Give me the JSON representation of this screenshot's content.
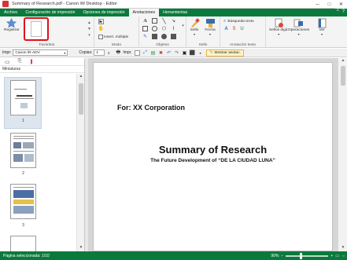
{
  "window": {
    "title": "Summary of Research.pdf - Canon iW Desktop - Editor",
    "minimize": "─",
    "maximize": "□",
    "close": "✕"
  },
  "menu": {
    "tabs": [
      {
        "label": "Archivo",
        "active": false
      },
      {
        "label": "Configuración de impresión",
        "active": false
      },
      {
        "label": "Opciones de impresión",
        "active": false
      },
      {
        "label": "Anotaciones",
        "active": true
      },
      {
        "label": "Herramientas",
        "active": false
      }
    ],
    "help": "?",
    "collapse": "^"
  },
  "ribbon": {
    "register_label": "Registrar",
    "insert_multiple": "Insert. múltiple",
    "stamp_label": "Sello",
    "date_label": "Fecha",
    "search_text_label": "Búsqueda texto",
    "digital_stamps_label": "Sellos digit.",
    "operations_label": "Operaciones",
    "view_label": "Ver",
    "groups": {
      "favorites": "Favoritos",
      "mode": "Modo",
      "objects": "Objetos",
      "stamp": "Sello",
      "text_annotation": "Anotación texto"
    }
  },
  "toolbar": {
    "printer_label": "Impr:",
    "printer_value": "Canon iR-ADV",
    "copies_label": "Copias:",
    "copies_value": "1",
    "print_label": "Impr.",
    "show_annotations": "Mostrar anotac."
  },
  "sidepanel": {
    "header": "Miniaturas",
    "pages": [
      "1",
      "2",
      "3"
    ]
  },
  "document": {
    "for_line": "For: XX Corporation",
    "title": "Summary of Research",
    "subtitle": "The Future Development of “DE LA CIUDAD LUNA”"
  },
  "status": {
    "selected_page": "Página seleccionada: 1/10",
    "zoom": "90%"
  },
  "colors": {
    "accent": "#0a7a3c",
    "highlight_border": "#e0101a"
  }
}
